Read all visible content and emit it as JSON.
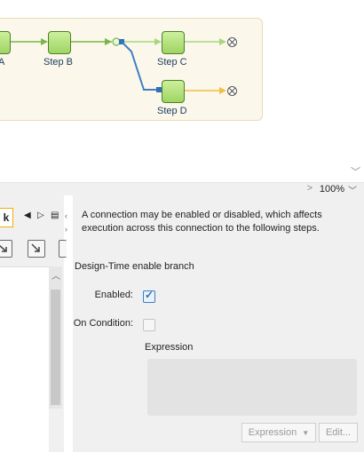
{
  "diagram": {
    "steps": [
      {
        "label": "A"
      },
      {
        "label": "Step B"
      },
      {
        "label": "Step C"
      },
      {
        "label": "Step D"
      }
    ]
  },
  "statusbar": {
    "zoom": "100%"
  },
  "left_panel": {
    "tab_label": "k"
  },
  "properties": {
    "description": "A connection may be enabled or disabled, which affects execution across this connection to the following steps.",
    "section_title": "Design-Time enable branch",
    "enabled_label": "Enabled:",
    "enabled_checked": true,
    "on_condition_label": "On Condition:",
    "on_condition_checked": false,
    "expression_label": "Expression",
    "expression_button": "Expression",
    "edit_button": "Edit..."
  },
  "colors": {
    "accent_blue": "#2f6fba",
    "connector_green": "#7ab648",
    "connector_light_green": "#a8d87a",
    "connector_yellow": "#f0c040"
  }
}
